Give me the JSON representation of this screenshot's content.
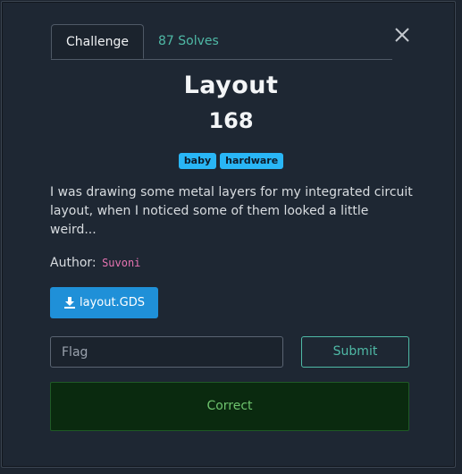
{
  "tabs": {
    "challenge": "Challenge",
    "solves": "87 Solves"
  },
  "challenge": {
    "title": "Layout",
    "points": "168",
    "tags": [
      "baby",
      "hardware"
    ],
    "description": "I was drawing some metal layers for my integrated circuit layout, when I noticed some of them looked a little weird...",
    "author_label": "Author:",
    "author_name": "Suvoni",
    "file_label": "layout.GDS"
  },
  "form": {
    "flag_placeholder": "Flag",
    "submit_label": "Submit"
  },
  "result": {
    "message": "Correct"
  },
  "colors": {
    "accent_teal": "#4fb9a6",
    "tag_blue": "#29b6f6",
    "file_button": "#1f90d8",
    "success_bg": "#0a2a0f"
  }
}
